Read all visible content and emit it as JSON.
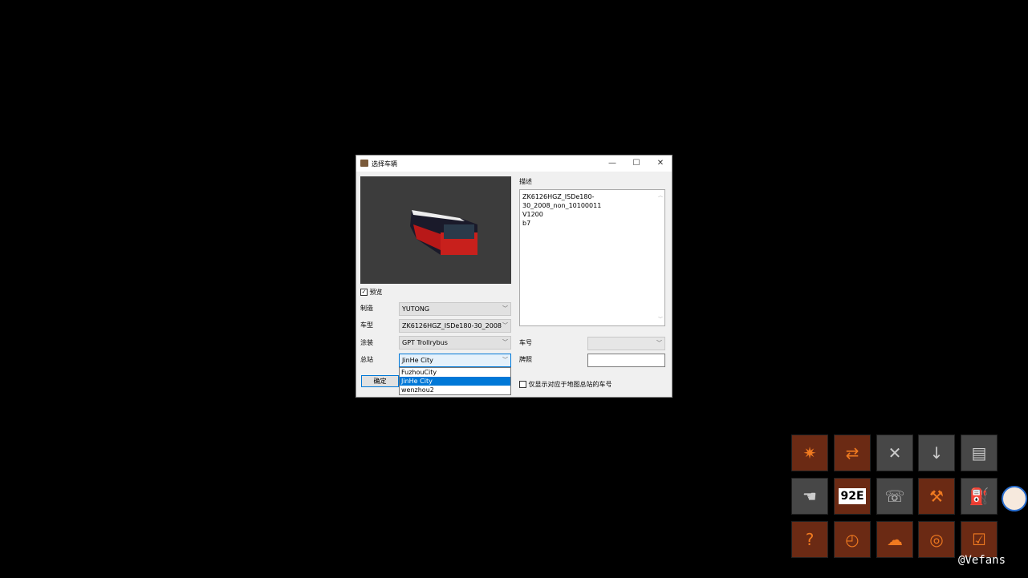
{
  "dialog": {
    "title": "选择车辆",
    "controls": {
      "minimize": "—",
      "maximize": "☐",
      "close": "✕"
    },
    "preview_checkbox": {
      "label": "预览",
      "checked": true
    },
    "fields": [
      {
        "label": "制造",
        "value": "YUTONG"
      },
      {
        "label": "车型",
        "value": "ZK6126HGZ_ISDe180-30_2008"
      },
      {
        "label": "涂装",
        "value": "GPT Trollrybus"
      },
      {
        "label": "总站",
        "value": "JinHe City"
      }
    ],
    "depot_options": [
      "FuzhouCity",
      "JinHe City",
      "wenzhou2"
    ],
    "depot_selected": "JinHe City",
    "ok_button": "确定",
    "description_label": "描述",
    "description_lines": [
      "ZK6126HGZ_ISDe180-",
      "30_2008_non_10100011",
      "V1200",
      "b7"
    ],
    "bus_number_label": "车号",
    "bus_number_value": "",
    "plate_label": "牌照",
    "plate_value": "",
    "filter_checkbox": {
      "label": "仅显示对应于地图总站的车号",
      "checked": false
    }
  },
  "toolbar_icons": [
    {
      "name": "bus-light-icon",
      "color": "#6b2a14"
    },
    {
      "name": "bus-swap-icon",
      "color": "#6b2a14"
    },
    {
      "name": "bus-remove-icon",
      "color": "#474747"
    },
    {
      "name": "bus-download-icon",
      "color": "#474747"
    },
    {
      "name": "bus-cpu-icon",
      "color": "#474747"
    },
    {
      "name": "touch-panel-icon",
      "color": "#474747"
    },
    {
      "name": "route-sign-icon",
      "color": "#6b2a14",
      "text": "92E"
    },
    {
      "name": "emergency-call-icon",
      "color": "#474747"
    },
    {
      "name": "repair-tools-icon",
      "color": "#6b2a14"
    },
    {
      "name": "fuel-pump-icon",
      "color": "#474747"
    },
    {
      "name": "help-arrow-icon",
      "color": "#6b2a14"
    },
    {
      "name": "clock-icon",
      "color": "#6b2a14"
    },
    {
      "name": "weather-icon",
      "color": "#6b2a14"
    },
    {
      "name": "driver-seat-icon",
      "color": "#6b2a14"
    },
    {
      "name": "checklist-icon",
      "color": "#6b2a14"
    }
  ],
  "watermark": "@Vefans"
}
